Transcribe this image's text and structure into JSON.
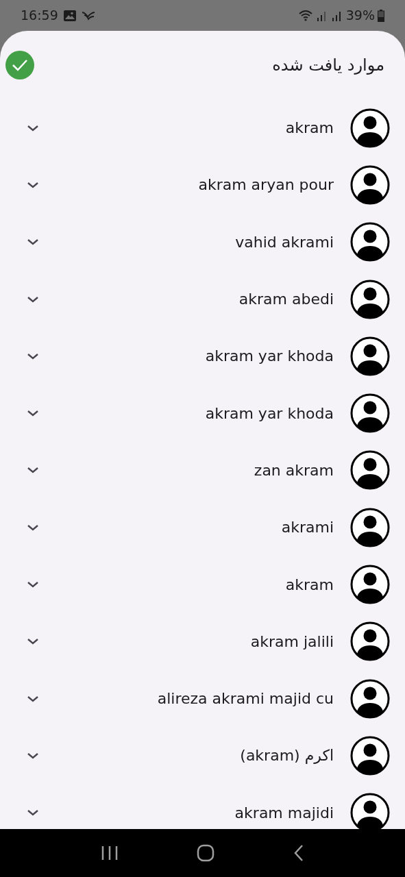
{
  "status_bar": {
    "time": "16:59",
    "battery": "39%"
  },
  "header": {
    "title": "موارد یافت شده",
    "confirm": {
      "checked": true
    }
  },
  "contacts": [
    {
      "name": "akram"
    },
    {
      "name": "akram aryan pour"
    },
    {
      "name": "vahid akrami"
    },
    {
      "name": "akram abedi"
    },
    {
      "name": "akram yar khoda"
    },
    {
      "name": "akram yar khoda"
    },
    {
      "name": "zan akram"
    },
    {
      "name": "akrami"
    },
    {
      "name": "akram"
    },
    {
      "name": "akram jalili"
    },
    {
      "name": "alireza akrami majid cu"
    },
    {
      "name": "اکرم (akram)"
    },
    {
      "name": "akram majidi"
    }
  ]
}
